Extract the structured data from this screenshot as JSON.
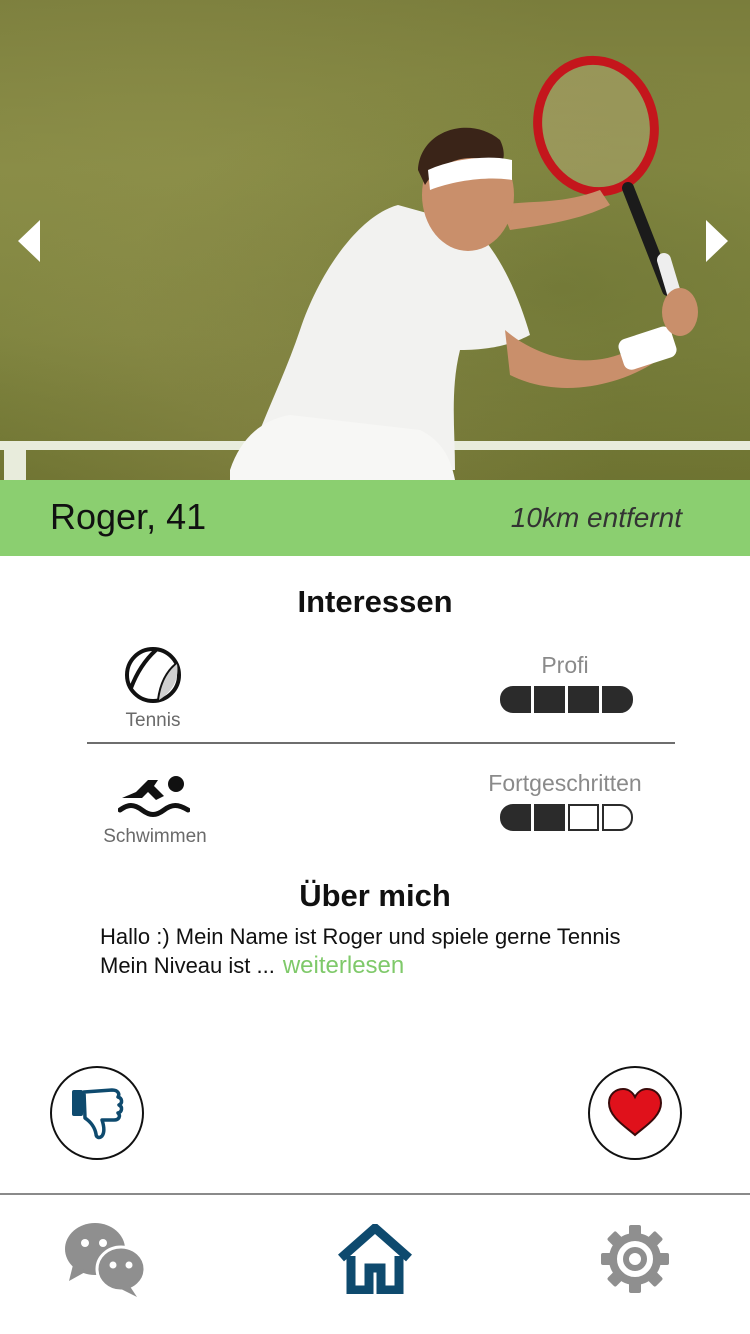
{
  "profile": {
    "name_age": "Roger, 41",
    "distance": "10km entfernt"
  },
  "interests": {
    "title": "Interessen",
    "items": [
      {
        "name": "Tennis",
        "icon": "tennis-ball-icon",
        "level": "Profi",
        "level_value": 4,
        "level_max": 4
      },
      {
        "name": "Schwimmen",
        "icon": "swimmer-icon",
        "level": "Fortgeschritten",
        "level_value": 2,
        "level_max": 4
      }
    ]
  },
  "about": {
    "title": "Über mich",
    "text_line1": "Hallo :) Mein Name ist Roger und spiele gerne Tennis",
    "text_line2": "Mein Niveau ist ...",
    "read_more": "weiterlesen"
  },
  "actions": {
    "dislike_icon": "thumbs-down-icon",
    "like_icon": "heart-icon"
  },
  "bottom_nav": {
    "items": [
      {
        "icon": "chat-icon"
      },
      {
        "icon": "home-icon",
        "active": true
      },
      {
        "icon": "gear-icon"
      }
    ]
  },
  "colors": {
    "accent_green": "#8bcf70",
    "link_green": "#7fc96a",
    "home_blue": "#0e4a6e",
    "heart_red": "#e0111b",
    "icon_gray": "#8f8f8f"
  }
}
